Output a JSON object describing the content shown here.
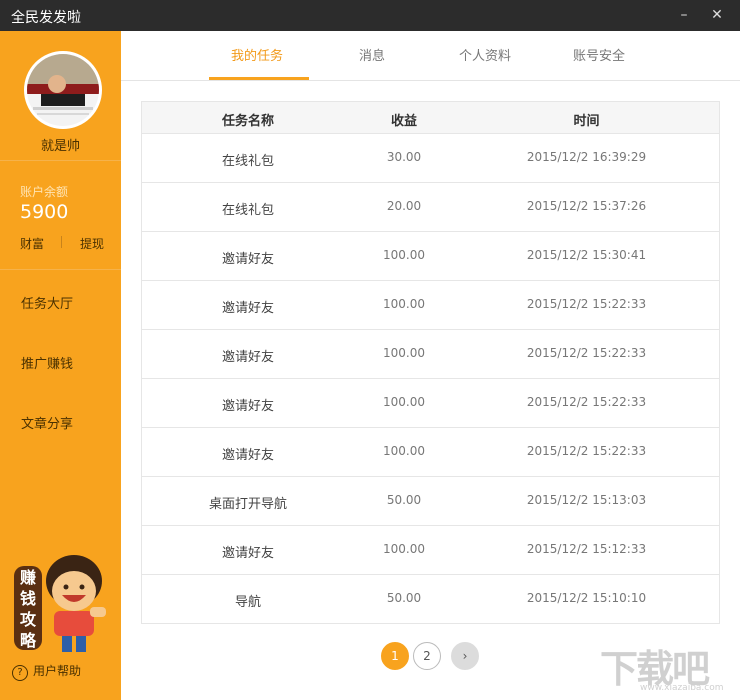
{
  "window": {
    "title": "全民发发啦",
    "minimize": "–",
    "close": "✕"
  },
  "sidebar": {
    "username": "就是帅",
    "balance_label": "账户余额",
    "balance_value": "5900",
    "links": [
      "财富",
      "提现"
    ],
    "nav": [
      "任务大厅",
      "推广赚钱",
      "文章分享"
    ],
    "promo_label": [
      "赚",
      "钱",
      "攻",
      "略"
    ],
    "help": "用户帮助"
  },
  "tabs": [
    "我的任务",
    "消息",
    "个人资料",
    "账号安全"
  ],
  "table": {
    "headers": [
      "任务名称",
      "收益",
      "时间"
    ],
    "rows": [
      [
        "在线礼包",
        "30.00",
        "2015/12/2 16:39:29"
      ],
      [
        "在线礼包",
        "20.00",
        "2015/12/2 15:37:26"
      ],
      [
        "邀请好友",
        "100.00",
        "2015/12/2 15:30:41"
      ],
      [
        "邀请好友",
        "100.00",
        "2015/12/2 15:22:33"
      ],
      [
        "邀请好友",
        "100.00",
        "2015/12/2 15:22:33"
      ],
      [
        "邀请好友",
        "100.00",
        "2015/12/2 15:22:33"
      ],
      [
        "邀请好友",
        "100.00",
        "2015/12/2 15:22:33"
      ],
      [
        "桌面打开导航",
        "50.00",
        "2015/12/2 15:13:03"
      ],
      [
        "邀请好友",
        "100.00",
        "2015/12/2 15:12:33"
      ],
      [
        "导航",
        "50.00",
        "2015/12/2 15:10:10"
      ]
    ]
  },
  "pagination": {
    "pages": [
      "1",
      "2"
    ],
    "next": "›",
    "current": "1"
  },
  "watermark": {
    "main": "下载吧",
    "sub": "www.xiazaiba.com"
  },
  "colors": {
    "accent": "#f8a31e",
    "titlebar": "#2c2c2c"
  }
}
